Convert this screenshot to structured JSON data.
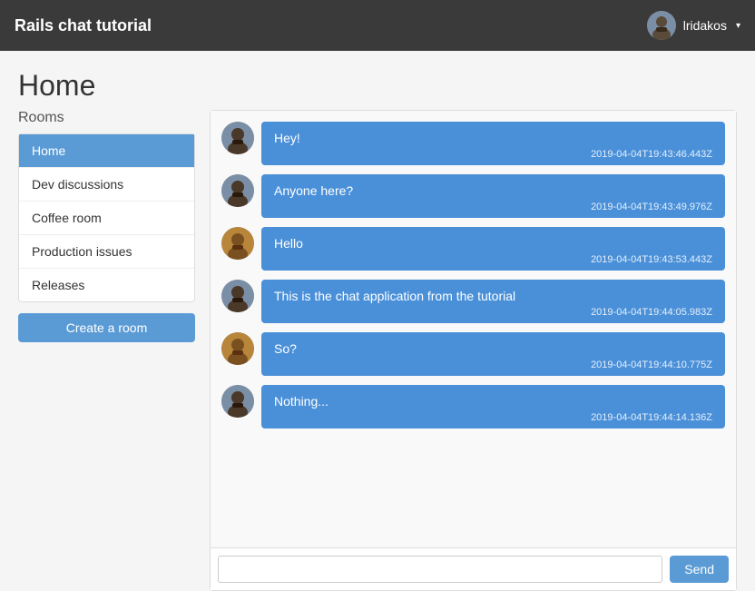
{
  "navbar": {
    "brand": "Rails chat tutorial",
    "user": {
      "name": "lridakos",
      "dropdown_arrow": "▾"
    }
  },
  "page": {
    "title": "Home"
  },
  "sidebar": {
    "rooms_label": "Rooms",
    "items": [
      {
        "id": "home",
        "label": "Home",
        "active": true
      },
      {
        "id": "dev-discussions",
        "label": "Dev discussions",
        "active": false
      },
      {
        "id": "coffee-room",
        "label": "Coffee room",
        "active": false
      },
      {
        "id": "production-issues",
        "label": "Production issues",
        "active": false
      },
      {
        "id": "releases",
        "label": "Releases",
        "active": false
      }
    ],
    "create_room_label": "Create a room"
  },
  "chat": {
    "messages": [
      {
        "id": "msg-1",
        "avatar_type": "dark",
        "text": "Hey!",
        "time": "2019-04-04T19:43:46.443Z"
      },
      {
        "id": "msg-2",
        "avatar_type": "dark",
        "text": "Anyone here?",
        "time": "2019-04-04T19:43:49.976Z"
      },
      {
        "id": "msg-3",
        "avatar_type": "orange",
        "text": "Hello",
        "time": "2019-04-04T19:43:53.443Z"
      },
      {
        "id": "msg-4",
        "avatar_type": "dark",
        "text": "This is the chat application from the tutorial",
        "time": "2019-04-04T19:44:05.983Z"
      },
      {
        "id": "msg-5",
        "avatar_type": "orange",
        "text": "So?",
        "time": "2019-04-04T19:44:10.775Z"
      },
      {
        "id": "msg-6",
        "avatar_type": "dark",
        "text": "Nothing...",
        "time": "2019-04-04T19:44:14.136Z"
      }
    ],
    "input_placeholder": "",
    "send_label": "Send"
  }
}
